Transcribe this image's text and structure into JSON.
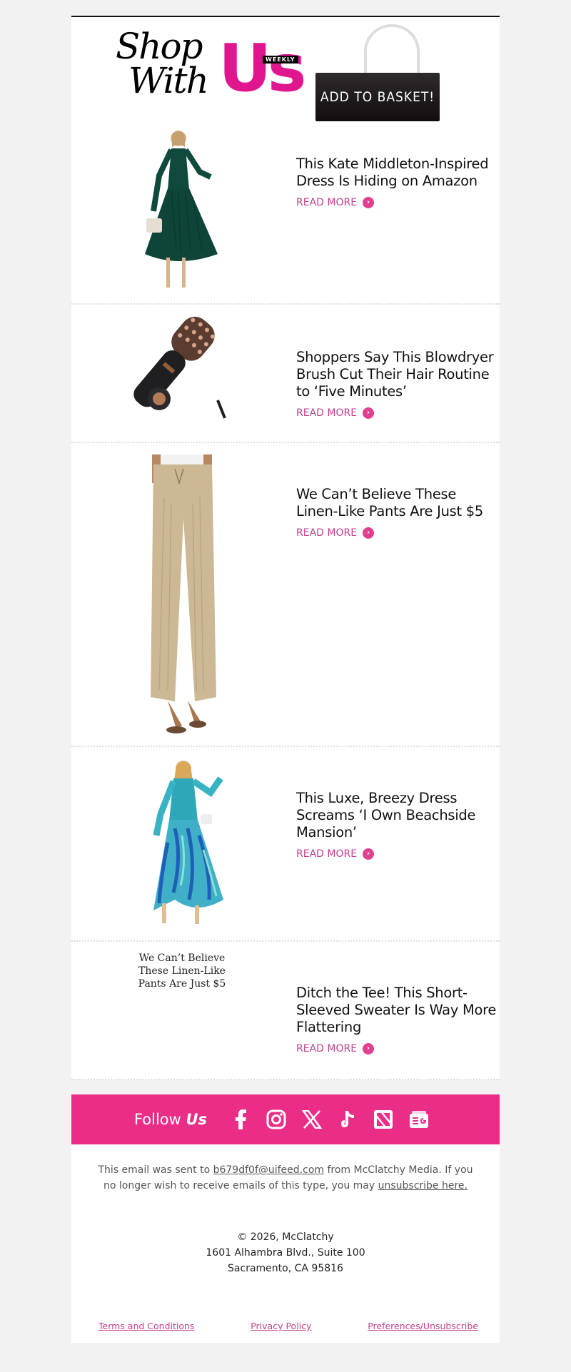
{
  "header": {
    "logo_shop": "Shop",
    "logo_with": "With",
    "logo_us": "Us",
    "logo_weekly": "WEEKLY",
    "basket_label": "ADD TO BASKET!",
    "accent_color": "#e0168f"
  },
  "articles": [
    {
      "title": "This Kate Middleton-Inspired Dress Is Hiding on Amazon",
      "cta": "READ MORE",
      "image": "green-pleated-dress"
    },
    {
      "title": "Shoppers Say This Blowdryer Brush Cut Their Hair Routine to ‘Five Minutes’",
      "cta": "READ MORE",
      "image": "blowdryer-brush"
    },
    {
      "title": "We Can’t Believe These Linen-Like Pants Are Just $5",
      "cta": "READ MORE",
      "image": "linen-pants"
    },
    {
      "title": "This Luxe, Breezy Dress Screams ‘I Own Beachside Mansion’",
      "cta": "READ MORE",
      "image": "blue-print-dress"
    },
    {
      "title": "Ditch the Tee! This Short-Sleeved Sweater Is Way More Flattering",
      "cta": "READ MORE",
      "image_alt": "We Can’t Believe These Linen-Like Pants Are Just $5"
    }
  ],
  "follow": {
    "label": "Follow",
    "label_em": "Us",
    "background": "#ea2d87",
    "icons": [
      "facebook-icon",
      "instagram-icon",
      "x-icon",
      "tiktok-icon",
      "apple-news-icon",
      "google-news-icon"
    ]
  },
  "footer": {
    "sent_prefix": "This email was sent to",
    "email": "b679df0f@uifeed.com",
    "sent_middle": "from McClatchy Media. If you no longer wish to receive emails of this type, you may",
    "unsubscribe": "unsubscribe here.",
    "copyright": "© 2026, McClatchy",
    "address1": "1601 Alhambra Blvd., Suite 100",
    "address2": "Sacramento, CA 95816",
    "link_terms": "Terms and Conditions",
    "link_privacy": "Privacy Policy",
    "link_prefs": "Preferences/Unsubscribe"
  }
}
